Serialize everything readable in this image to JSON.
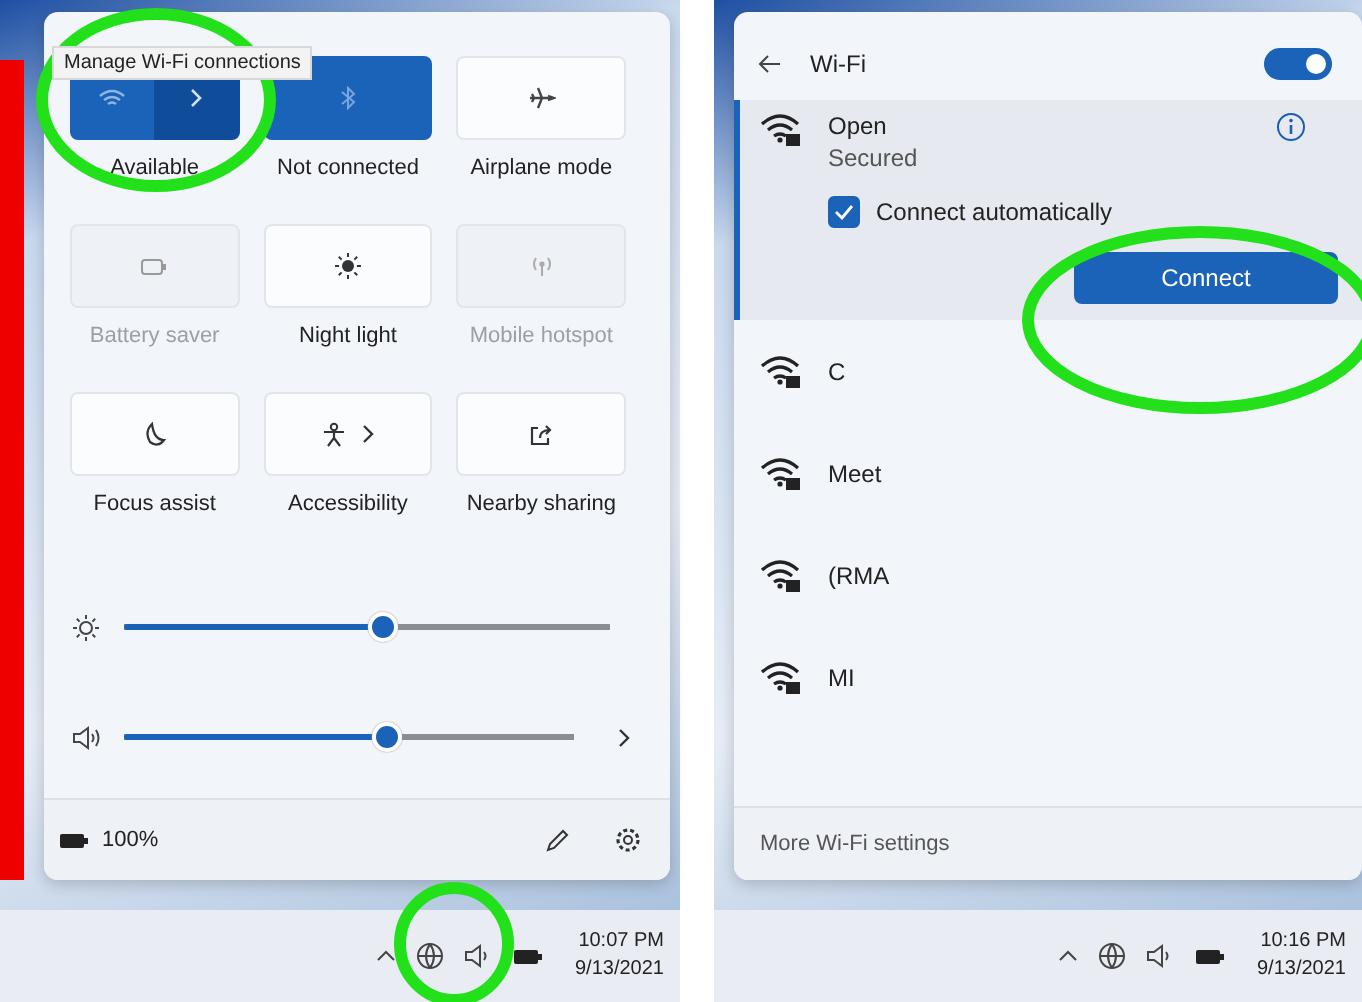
{
  "quick_settings": {
    "tooltip": "Manage Wi-Fi connections",
    "tiles": [
      {
        "kind": "wifi",
        "label": "Available",
        "on": true,
        "disabled": false,
        "chevron": true
      },
      {
        "kind": "bluetooth",
        "label": "Not connected",
        "on": true,
        "disabled": false,
        "chevron": false
      },
      {
        "kind": "airplane",
        "label": "Airplane mode",
        "on": false,
        "disabled": false,
        "chevron": false
      },
      {
        "kind": "battery",
        "label": "Battery saver",
        "on": false,
        "disabled": true,
        "chevron": false
      },
      {
        "kind": "brightness",
        "label": "Night light",
        "on": false,
        "disabled": false,
        "chevron": false
      },
      {
        "kind": "hotspot",
        "label": "Mobile hotspot",
        "on": false,
        "disabled": true,
        "chevron": false
      },
      {
        "kind": "moon",
        "label": "Focus assist",
        "on": false,
        "disabled": false,
        "chevron": false
      },
      {
        "kind": "accessibility",
        "label": "Accessibility",
        "on": false,
        "disabled": false,
        "chevron": true
      },
      {
        "kind": "share",
        "label": "Nearby sharing",
        "on": false,
        "disabled": false,
        "chevron": false
      }
    ],
    "sliders": [
      {
        "kind": "brightness",
        "level": 0.53,
        "chevron": false
      },
      {
        "kind": "volume",
        "level": 0.58,
        "chevron": true
      }
    ],
    "battery": "100%"
  },
  "taskbar_left": {
    "time": "10:07 PM",
    "date": "9/13/2021"
  },
  "wifi_panel": {
    "title": "Wi-Fi",
    "on": true,
    "networks": [
      {
        "name": "Open",
        "status": "Secured",
        "expanded": true,
        "connect_automatically": true,
        "option": "Connect automatically",
        "button": "Connect"
      },
      {
        "name": "C",
        "expanded": false
      },
      {
        "name": "Meet",
        "expanded": false
      },
      {
        "name": "(RMA",
        "expanded": false
      },
      {
        "name": "MI",
        "expanded": false
      }
    ],
    "footer": "More Wi-Fi settings"
  },
  "taskbar_right": {
    "time": "10:16 PM",
    "date": "9/13/2021"
  }
}
